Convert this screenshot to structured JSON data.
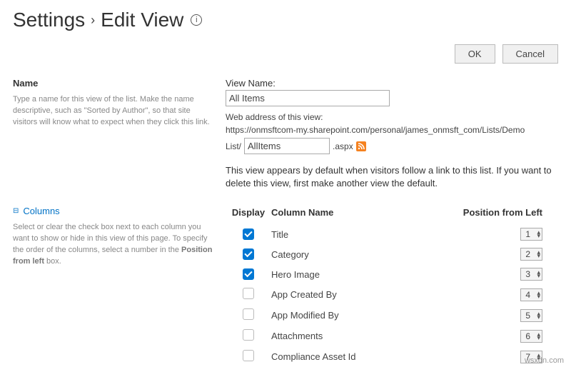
{
  "title": {
    "root": "Settings",
    "leaf": "Edit View"
  },
  "buttons": {
    "ok": "OK",
    "cancel": "Cancel"
  },
  "name_section": {
    "heading": "Name",
    "help": "Type a name for this view of the list. Make the name descriptive, such as \"Sorted by Author\", so that site visitors will know what to expect when they click this link.",
    "view_name_label": "View Name:",
    "view_name_value": "All Items",
    "web_addr_label": "Web address of this view:",
    "web_addr_url": "https://onmsftcom-my.sharepoint.com/personal/james_onmsft_com/Lists/Demo",
    "web_addr_prefix": "List/",
    "web_addr_page": "AllItems",
    "web_addr_suffix": ".aspx",
    "note": "This view appears by default when visitors follow a link to this list. If you want to delete this view, first make another view the default."
  },
  "columns_section": {
    "heading": "Columns",
    "help_pre": "Select or clear the check box next to each column you want to show or hide in this view of this page. To specify the order of the columns, select a number in the ",
    "help_bold": "Position from left",
    "help_post": " box.",
    "th_display": "Display",
    "th_colname": "Column Name",
    "th_position": "Position from Left",
    "rows": [
      {
        "checked": true,
        "name": "Title",
        "pos": "1"
      },
      {
        "checked": true,
        "name": "Category",
        "pos": "2"
      },
      {
        "checked": true,
        "name": "Hero Image",
        "pos": "3"
      },
      {
        "checked": false,
        "name": "App Created By",
        "pos": "4"
      },
      {
        "checked": false,
        "name": "App Modified By",
        "pos": "5"
      },
      {
        "checked": false,
        "name": "Attachments",
        "pos": "6"
      },
      {
        "checked": false,
        "name": "Compliance Asset Id",
        "pos": "7"
      }
    ]
  },
  "watermark": "wsxdn.com"
}
